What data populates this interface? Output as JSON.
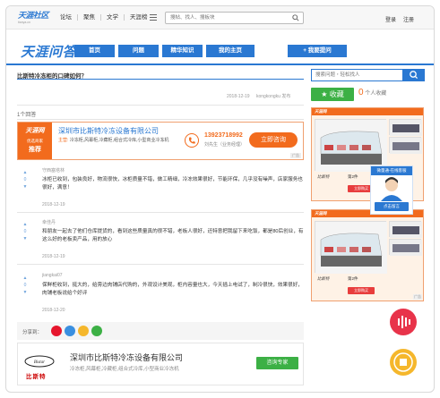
{
  "topbar": {
    "logo_main": "天涯社区",
    "logo_sub": "tianya.cn",
    "nav": [
      "论坛",
      "聚焦",
      "文学",
      "天涯榜"
    ],
    "search_placeholder": "搜帖、找人、搜板块",
    "login": "登录",
    "register": "注册"
  },
  "nav": {
    "brand": "天涯问答",
    "items": [
      "首页",
      "问题",
      "精华知识",
      "我的主页"
    ],
    "ask_label": "+ 我要提问"
  },
  "question": {
    "title": "比斯特冷冻柜的口碑如何？",
    "date": "2018-12-19",
    "author": "kongkongku 发布"
  },
  "answers_count": "1个回答",
  "main_ad": {
    "logo_text": "天涯网",
    "badge_small": "优选商家",
    "badge_big": "推荐",
    "company": "深圳市比斯特冷冻设备有限公司",
    "main_label": "主营:",
    "main_products": "冷冻柜,风幕柜,冷藏柜,组合式冷库,小型商业冷冻机",
    "phone": "13923718992",
    "contact": "刘先生（业务经理）",
    "consult": "立即咨询",
    "ad_tag": "广告"
  },
  "answers": [
    {
      "user": "守西塞塔林",
      "text": "冰柜已收到，包装良好，物流很快，冰柜质量不错，做工精细，冷冻效果很好，节能环保，几乎没有噪声，店家服务也很好，满意！",
      "date": "2018-12-19",
      "votes": "0"
    },
    {
      "user": "幸佳丹",
      "text": "和朋友一起去了他们仓库提货的，看到这些质量真的很不错，老板人很好，还特意把我留下来吃饭，都是80后创业，有这么好的老板卖产品，用的放心",
      "date": "2018-12-19",
      "votes": "0"
    },
    {
      "user": "jiangkai07",
      "text": "保鲜柜收到，挺大的，给旁边肉铺店代购的，外观设计美观，柜内容量也大，今天插上电试了，制冷很快，效果很好，肉铺老板说给个好评",
      "date": "2018-12-20",
      "votes": "0"
    }
  ],
  "share": {
    "label": "分享到："
  },
  "bottom_ad": {
    "brand": "比斯特",
    "company": "深圳市比斯特冷冻设备有限公司",
    "desc": "冷冻柜,风幕柜,冷藏柜,组合式冷库,小型商业冷冻机",
    "button": "咨询专家"
  },
  "sidebar": {
    "search_placeholder": "搜索问题・轻松找人",
    "collect_label": "收藏",
    "collect_count": "0",
    "collect_suffix": "个人收藏",
    "ad_logo": "天涯网",
    "brand_label": "比斯特",
    "rank_label": "第2件",
    "buy_label": "立即购买",
    "popup_title": "微量通-在线客服",
    "popup_btn": "点击留言",
    "ad_tag": "广告"
  },
  "colors": {
    "accent": "#2a78d2",
    "orange": "#f26b1d",
    "green": "#3cb045"
  }
}
